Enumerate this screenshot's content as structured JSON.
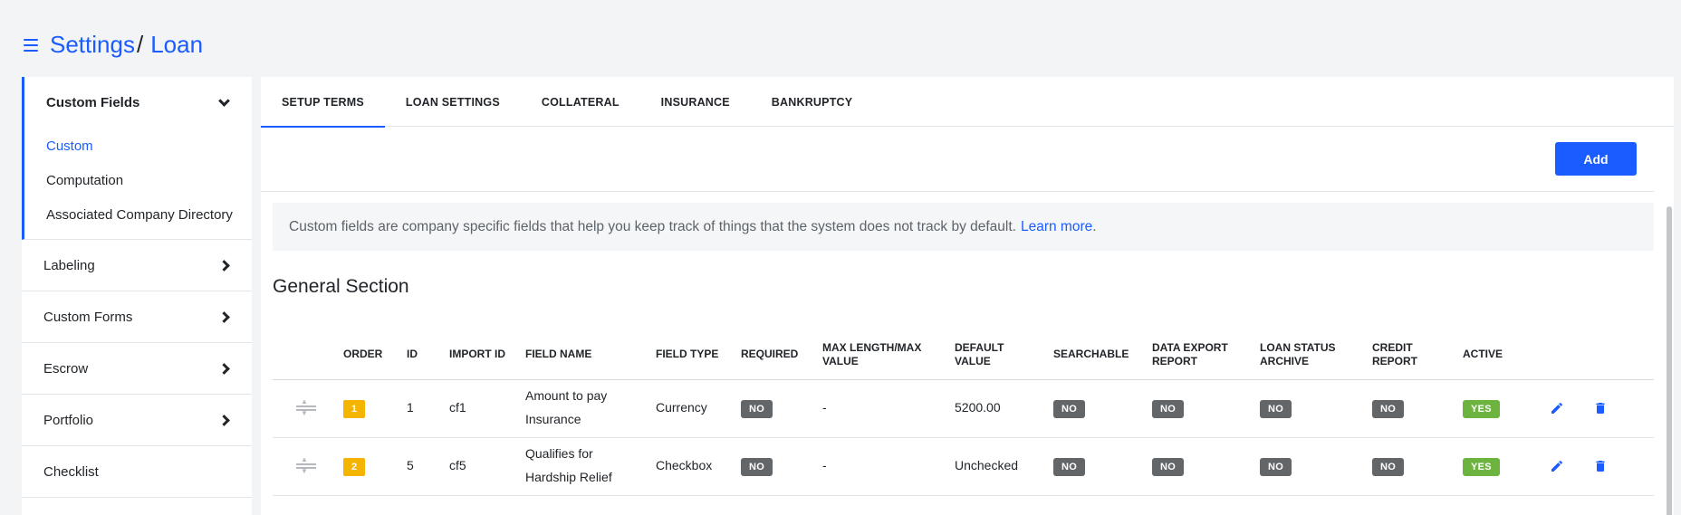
{
  "breadcrumb": {
    "root": "Settings",
    "separator": "/",
    "current": "Loan"
  },
  "sidebar": {
    "open_group": {
      "label": "Custom Fields",
      "items": [
        {
          "label": "Custom",
          "active": true
        },
        {
          "label": "Computation",
          "active": false
        },
        {
          "label": "Associated Company Directory",
          "active": false
        }
      ]
    },
    "groups": [
      {
        "label": "Labeling"
      },
      {
        "label": "Custom Forms"
      },
      {
        "label": "Escrow"
      },
      {
        "label": "Portfolio"
      },
      {
        "label": "Checklist"
      }
    ]
  },
  "tabs": [
    {
      "label": "SETUP TERMS",
      "active": true
    },
    {
      "label": "LOAN SETTINGS",
      "active": false
    },
    {
      "label": "COLLATERAL",
      "active": false
    },
    {
      "label": "INSURANCE",
      "active": false
    },
    {
      "label": "BANKRUPTCY",
      "active": false
    }
  ],
  "toolbar": {
    "add_label": "Add"
  },
  "info": {
    "text": "Custom fields are company specific fields that help you keep track of things that the system does not track by default.",
    "link": "Learn more",
    "suffix": "."
  },
  "section": {
    "title": "General Section"
  },
  "table": {
    "columns": {
      "order": "ORDER",
      "id": "ID",
      "import_id": "IMPORT ID",
      "field_name": "FIELD NAME",
      "field_type": "FIELD TYPE",
      "required": "REQUIRED",
      "max_length": "MAX LENGTH/MAX VALUE",
      "default_value": "DEFAULT VALUE",
      "searchable": "SEARCHABLE",
      "data_export": "DATA EXPORT REPORT",
      "loan_status_archive": "LOAN STATUS ARCHIVE",
      "credit_report": "CREDIT REPORT",
      "active": "ACTIVE"
    },
    "rows": [
      {
        "order": "1",
        "id": "1",
        "import_id": "cf1",
        "field_name": "Amount to pay Insurance",
        "field_type": "Currency",
        "required": "NO",
        "max_length": "-",
        "default_value": "5200.00",
        "searchable": "NO",
        "data_export": "NO",
        "loan_status_archive": "NO",
        "credit_report": "NO",
        "active": "YES"
      },
      {
        "order": "2",
        "id": "5",
        "import_id": "cf5",
        "field_name": "Qualifies for Hardship Relief",
        "field_type": "Checkbox",
        "required": "NO",
        "max_length": "-",
        "default_value": "Unchecked",
        "searchable": "NO",
        "data_export": "NO",
        "loan_status_archive": "NO",
        "credit_report": "NO",
        "active": "YES"
      }
    ]
  },
  "colors": {
    "accent": "#1a5cff",
    "order_badge": "#f5b400",
    "yes": "#6cb33f",
    "no": "#636669"
  }
}
